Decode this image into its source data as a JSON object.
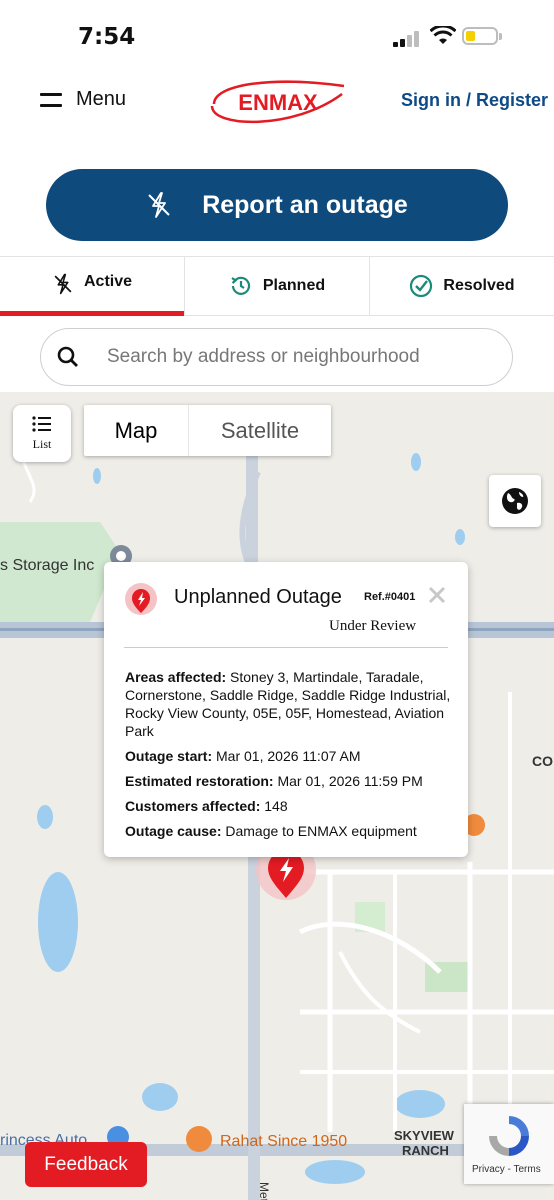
{
  "status_bar": {
    "time": "7:54"
  },
  "header": {
    "menu_label": "Menu",
    "logo_text": "ENMAX",
    "signin_label": "Sign in / Register"
  },
  "report_button": {
    "label": "Report an outage",
    "icon": "lightning-slash-icon"
  },
  "tabs": [
    {
      "label": "Active",
      "icon": "lightning-slash-icon",
      "selected": true
    },
    {
      "label": "Planned",
      "icon": "clock-history-icon",
      "selected": false
    },
    {
      "label": "Resolved",
      "icon": "check-circle-icon",
      "selected": false
    }
  ],
  "search": {
    "placeholder": "Search by address or neighbourhood"
  },
  "map": {
    "list_label": "List",
    "map_type": [
      "Map",
      "Satellite"
    ],
    "labels": {
      "storage": "s Storage Inc",
      "princess": "rincess Auto",
      "rahat": "Rahat Since 1950",
      "skyview1": "SKYVIEW",
      "skyview2": "RANCH",
      "metis": "Metis",
      "co": "CO"
    }
  },
  "popup": {
    "title": "Unplanned Outage",
    "ref": "Ref.#0401",
    "status": "Under Review",
    "areas_label": "Areas affected:",
    "areas_value": "Stoney 3, Martindale, Taradale, Cornerstone, Saddle Ridge, Saddle Ridge Industrial, Rocky View County, 05E, 05F, Homestead, Aviation Park",
    "start_label": "Outage start:",
    "start_value": "Mar 01, 2026 11:07 AM",
    "restoration_label": "Estimated restoration:",
    "restoration_value": "Mar 01, 2026 11:59 PM",
    "customers_label": "Customers affected:",
    "customers_value": "148",
    "cause_label": "Outage cause:",
    "cause_value": "Damage to ENMAX equipment"
  },
  "feedback_label": "Feedback",
  "recaptcha": {
    "links": "Privacy - Terms"
  },
  "colors": {
    "brand_blue": "#0f4a7c",
    "accent_red": "#e31b23",
    "link_blue": "#0e4a86"
  }
}
